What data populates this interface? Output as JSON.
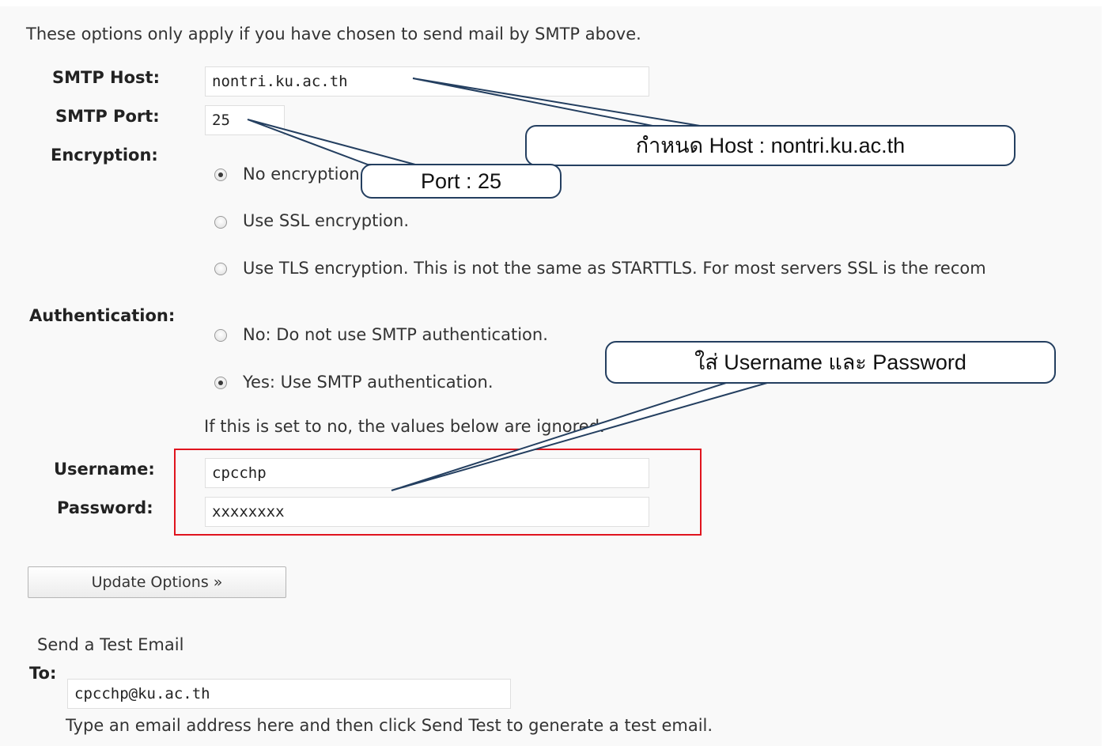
{
  "intro": "These options only apply if you have chosen to send mail by SMTP above.",
  "smtp_host": {
    "label": "SMTP Host:",
    "value": "nontri.ku.ac.th"
  },
  "smtp_port": {
    "label": "SMTP Port:",
    "value": "25"
  },
  "encryption": {
    "label": "Encryption:",
    "selected": 0,
    "options": [
      "No encryption.",
      "Use SSL encryption.",
      "Use TLS encryption. This is not the same as STARTTLS. For most servers SSL is the recom"
    ]
  },
  "authentication": {
    "label": "Authentication:",
    "selected": 1,
    "options": [
      "No: Do not use SMTP authentication.",
      "Yes: Use SMTP authentication."
    ],
    "note": "If this is set to no, the values below are ignored."
  },
  "username": {
    "label": "Username:",
    "value": "cpcchp"
  },
  "password": {
    "label": "Password:",
    "value": "xxxxxxxx"
  },
  "update_button": "Update Options »",
  "test_email": {
    "heading": "Send a Test Email",
    "to_label": "To:",
    "to_value": "cpcchp@ku.ac.th",
    "help": "Type an email address here and then click Send Test to generate a test email."
  },
  "annotations": {
    "host": "กำหนด Host : nontri.ku.ac.th",
    "port": "Port : 25",
    "credentials": "ใส่ Username และ Password"
  },
  "colors": {
    "highlight_box": "#e0141e",
    "callout_border": "#243f60"
  }
}
